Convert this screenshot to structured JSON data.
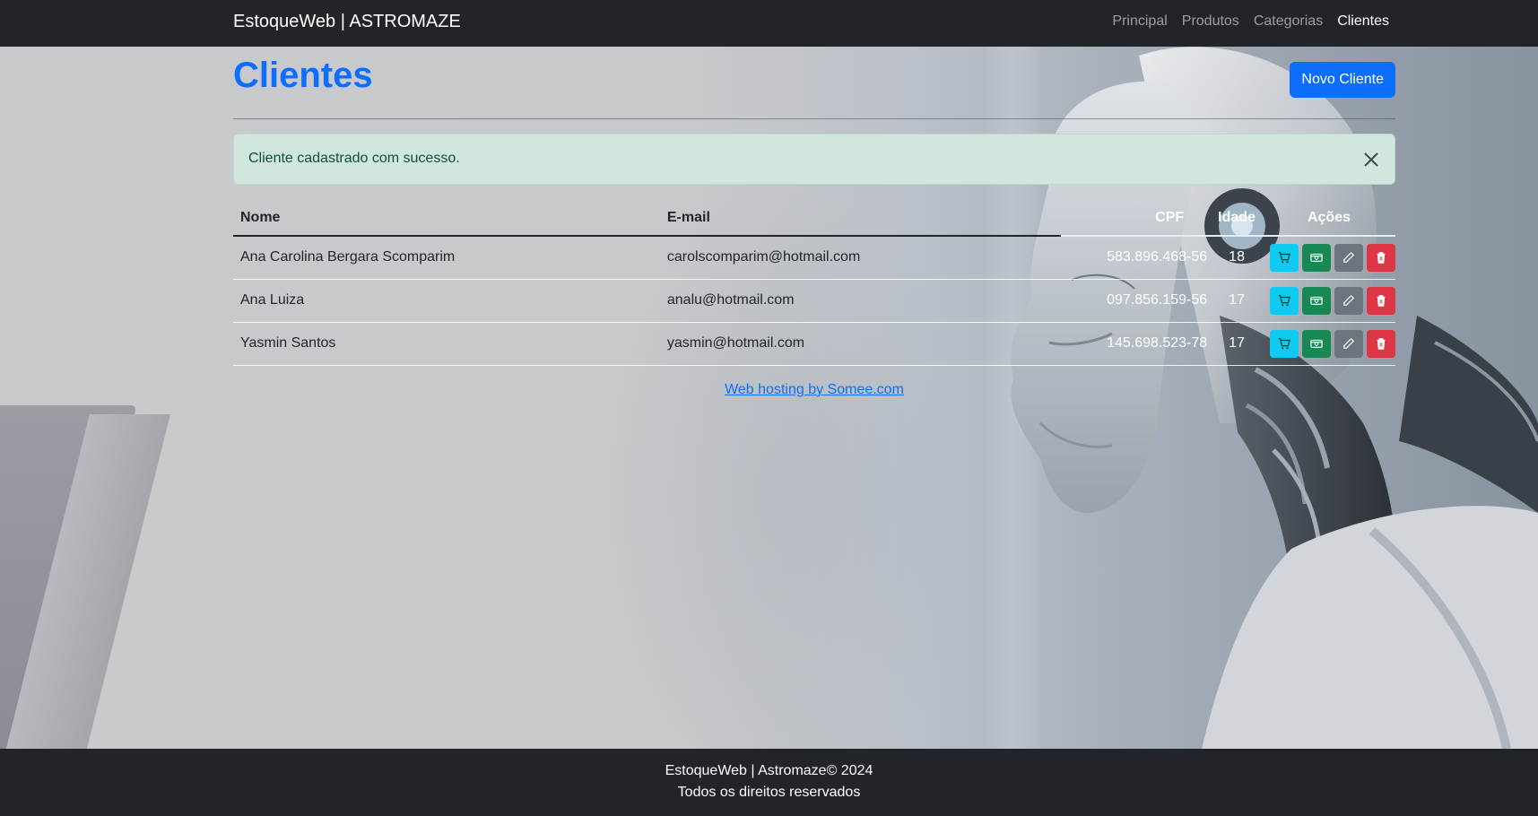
{
  "navbar": {
    "brand": "EstoqueWeb | ASTROMAZE",
    "links": [
      {
        "label": "Principal"
      },
      {
        "label": "Produtos"
      },
      {
        "label": "Categorias"
      },
      {
        "label": "Clientes"
      }
    ]
  },
  "page": {
    "title": "Clientes",
    "new_button": "Novo Cliente"
  },
  "alert": {
    "message": "Cliente cadastrado com sucesso."
  },
  "table": {
    "headers": [
      "Nome",
      "E-mail",
      "CPF",
      "Idade",
      "Ações"
    ],
    "rows": [
      {
        "nome": "Ana Carolina Bergara Scomparim",
        "email": "carolscomparim@hotmail.com",
        "cpf": "583.896.468-56",
        "idade": "18"
      },
      {
        "nome": "Ana Luiza",
        "email": "analu@hotmail.com",
        "cpf": "097.856.159-56",
        "idade": "17"
      },
      {
        "nome": "Yasmin Santos",
        "email": "yasmin@hotmail.com",
        "cpf": "145.698.523-78",
        "idade": "17"
      }
    ],
    "action_icons": [
      "cart-icon",
      "cash-icon",
      "pencil-icon",
      "trash-icon"
    ]
  },
  "host_link": "Web hosting by Somee.com",
  "footer": {
    "line1": "EstoqueWeb | Astromaze© 2024",
    "line2": "Todos os direitos reservados"
  },
  "colors": {
    "navbar_bg": "#212529",
    "primary": "#0d6efd",
    "alert_bg": "#d1e7dd",
    "alert_text": "#0f5132",
    "info": "#0dcaf0",
    "success": "#198754",
    "secondary": "#6c757d",
    "danger": "#dc3545"
  }
}
